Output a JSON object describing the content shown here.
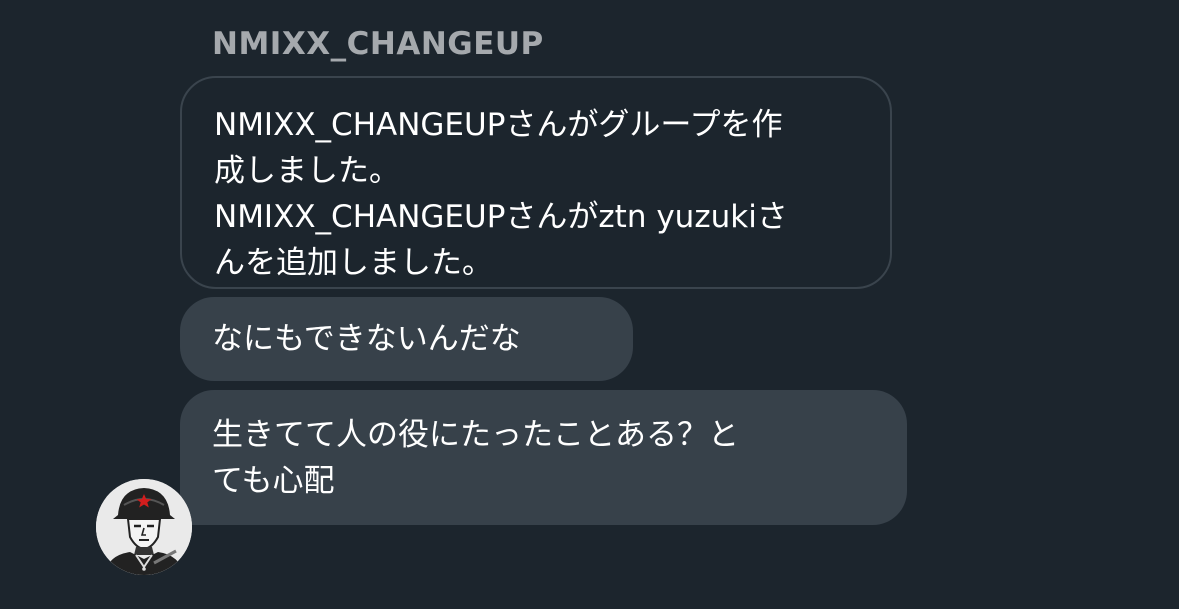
{
  "conversation": {
    "sender_name": "NMIXX_CHANGEUP",
    "system_notice": {
      "lines": [
        "NMIXX_CHANGEUPさんがグループを作",
        "成しました。",
        "NMIXX_CHANGEUPさんがztn yuzukiさ",
        "んを追加しました。"
      ]
    },
    "messages": [
      {
        "lines": [
          "なにもできないんだな"
        ]
      },
      {
        "lines": [
          "生きてて人の役にたったことある？と",
          "ても心配"
        ]
      }
    ],
    "avatar": {
      "icon": "soldier-avatar-icon"
    }
  },
  "colors": {
    "background": "#1c252d",
    "bubble": "#37414a",
    "system_border": "#3a444d",
    "sender_name": "#a5a9ad",
    "text": "#ffffff"
  }
}
